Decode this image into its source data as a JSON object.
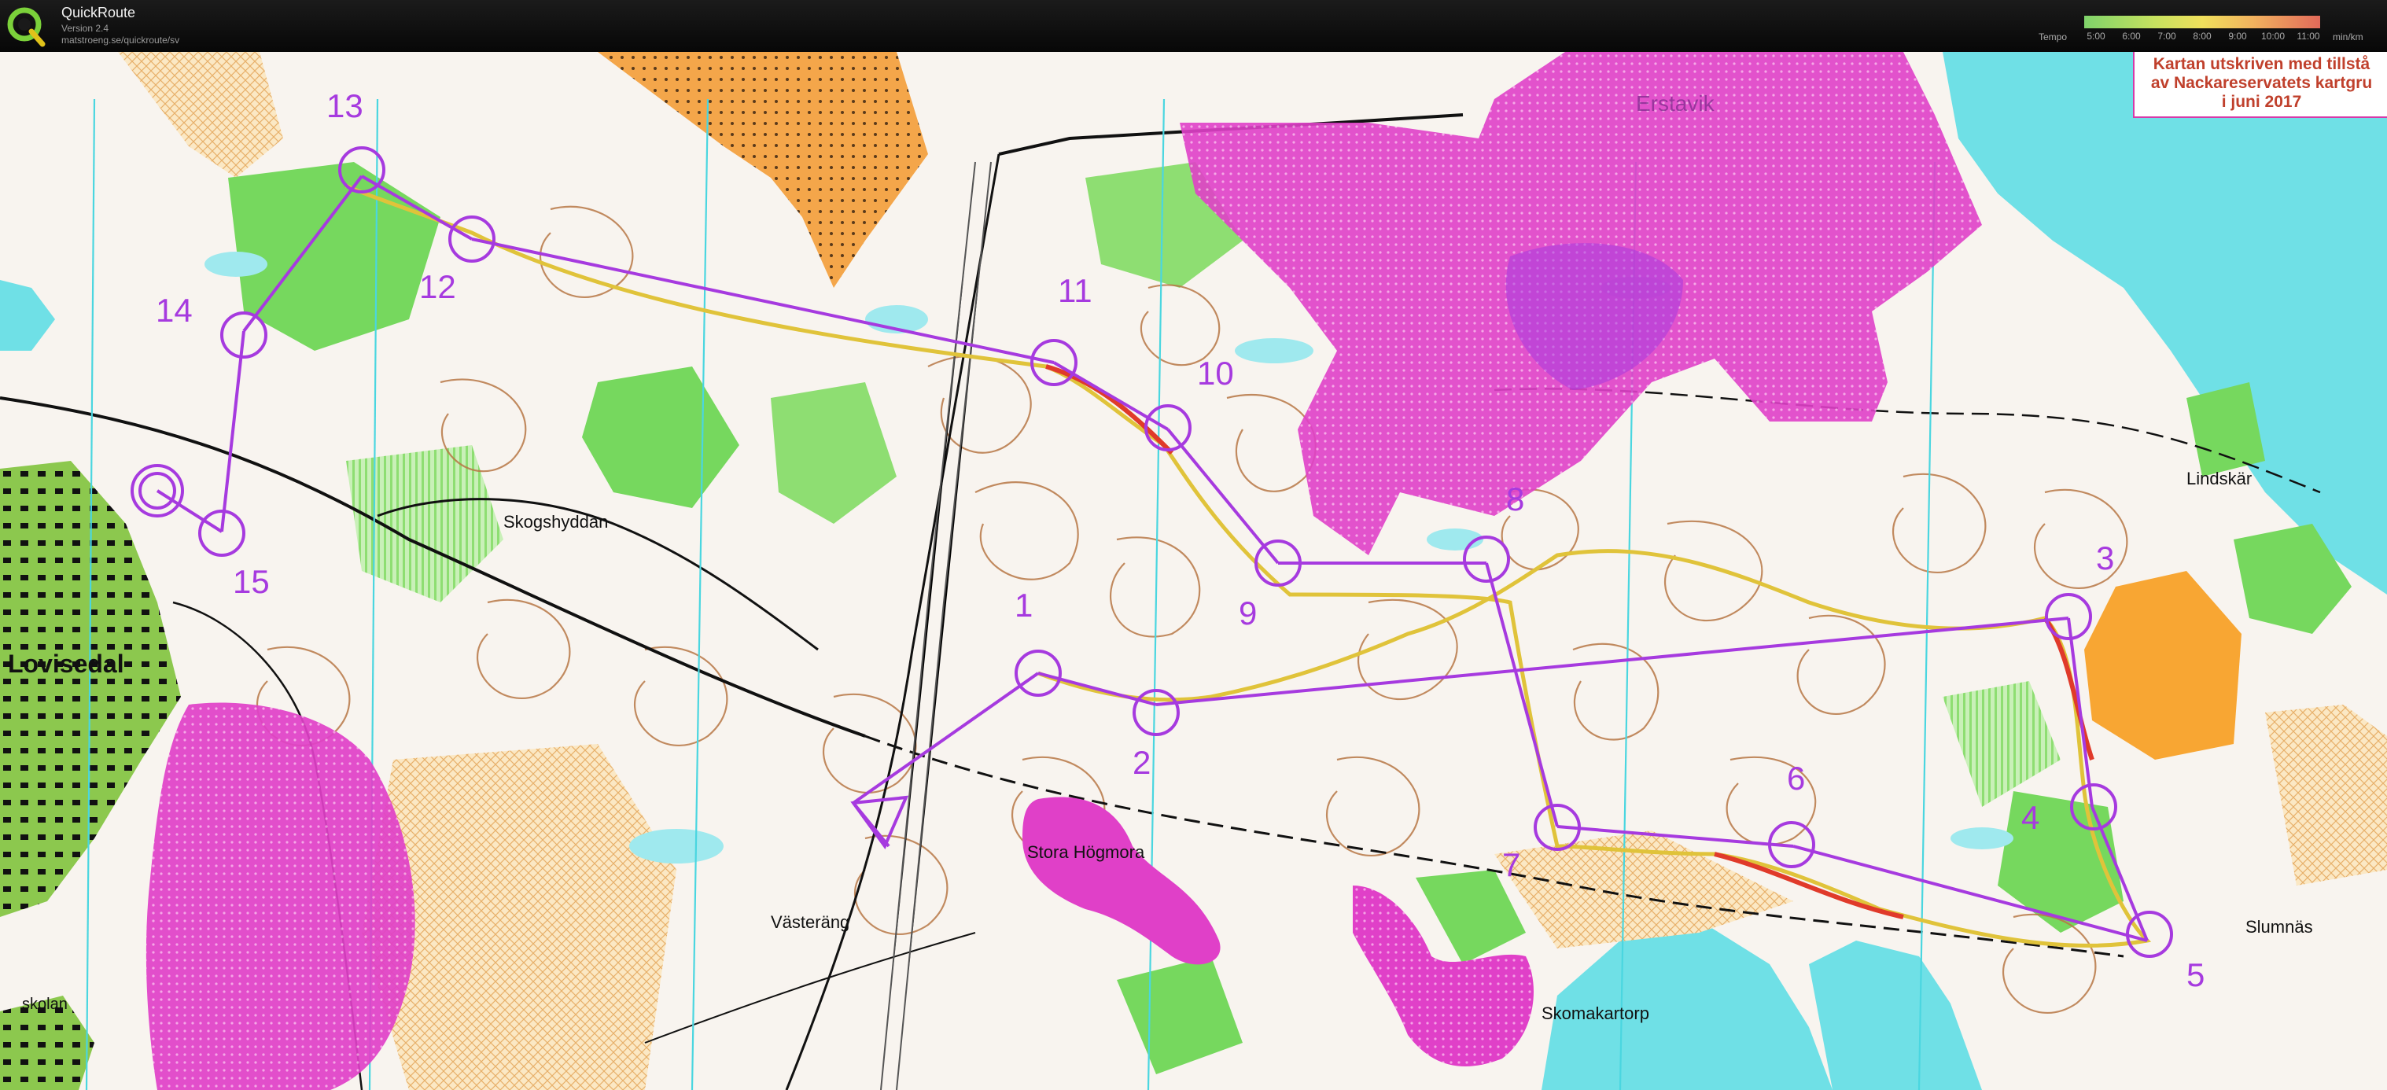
{
  "app": {
    "name": "QuickRoute",
    "version": "Version 2.4",
    "url": "matstroeng.se/quickroute/sv"
  },
  "tempo": {
    "label": "Tempo",
    "ticks": [
      "5:00",
      "6:00",
      "7:00",
      "8:00",
      "9:00",
      "10:00",
      "11:00"
    ],
    "unit": "min/km"
  },
  "map": {
    "permit_note": [
      "Kartan utskriven med tillstå",
      "av Nackareservatets kartgru",
      "i juni 2017"
    ],
    "place_names": {
      "erstavik": "Erstavik",
      "skogshyddan": "Skogshyddan",
      "lindskar": "Lindskär",
      "lovisedal": "Lovisedal",
      "stora_hogmora": "Stora Högmora",
      "vasterang": "Västeräng",
      "skomakartorp": "Skomakartorp",
      "slumnas": "Slumnäs",
      "skolan": "skolan"
    },
    "controls": [
      "1",
      "2",
      "3",
      "4",
      "5",
      "6",
      "7",
      "8",
      "9",
      "10",
      "11",
      "12",
      "13",
      "14",
      "15"
    ]
  },
  "colors": {
    "course_purple": "#a63adf",
    "restricted_magenta": "#e040c8",
    "forest_green": "#76d85e",
    "water_cyan": "#6fe0e6",
    "open_yellow": "#f8c272",
    "contour_brown": "#b77745",
    "route_red": "#e03a2a"
  }
}
